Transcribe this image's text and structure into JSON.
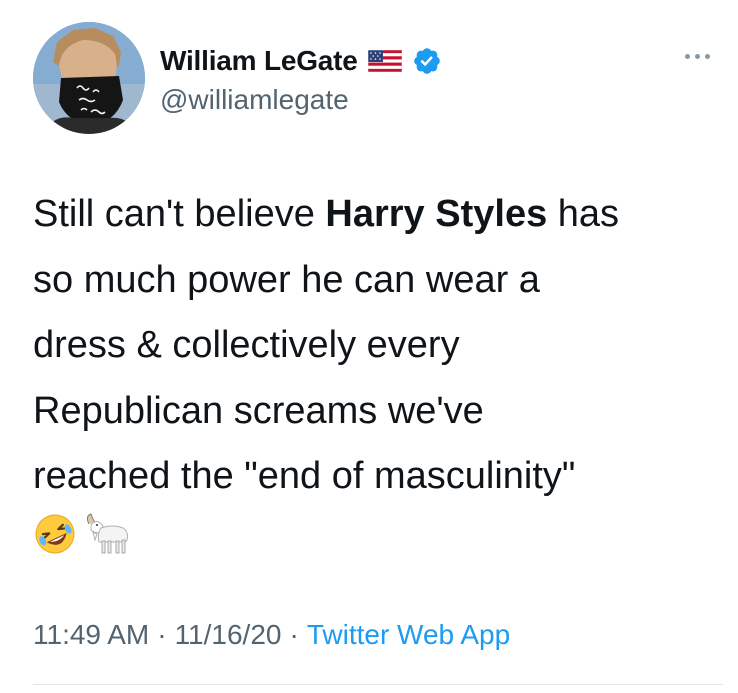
{
  "author": {
    "name": "William LeGate",
    "handle": "@williamlegate",
    "mask_text": [
      "person",
      "woman",
      "man",
      "camera"
    ]
  },
  "flag_icon": "us-flag-icon",
  "verified_icon": "verified-badge-icon",
  "more_icon": "more-options-icon",
  "tweet": {
    "lines": [
      {
        "before": "Still can't believe ",
        "bold": "Harry Styles",
        "after": " has"
      },
      {
        "before": "so much power he can wear a",
        "bold": "",
        "after": ""
      },
      {
        "before": "dress & collectively every",
        "bold": "",
        "after": ""
      },
      {
        "before": "Republican screams we've",
        "bold": "",
        "after": ""
      },
      {
        "before": "reached the \"end of masculinity\"",
        "bold": "",
        "after": ""
      }
    ],
    "emojis": [
      "rolling-on-floor-laughing-emoji",
      "goat-emoji"
    ]
  },
  "meta": {
    "time": "11:49 AM",
    "separator": "·",
    "date": "11/16/20",
    "source": "Twitter Web App"
  },
  "colors": {
    "text": "#0f1419",
    "secondary": "#536471",
    "link": "#1d9bf0",
    "verified": "#1d9bf0"
  }
}
